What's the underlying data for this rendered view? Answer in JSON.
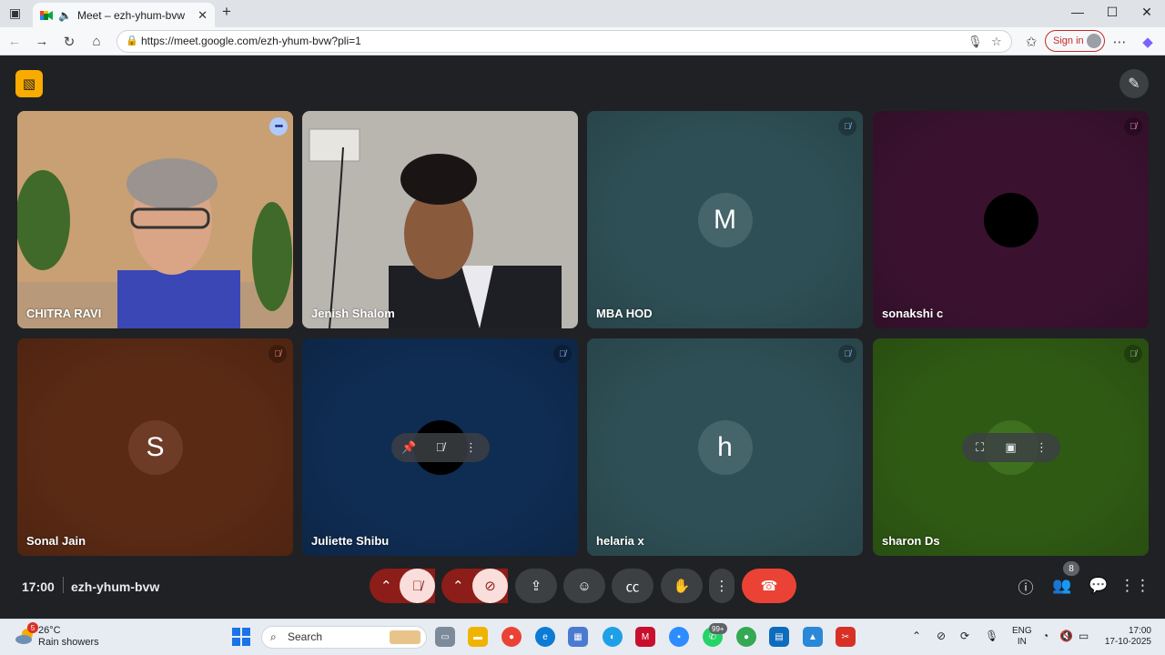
{
  "browser": {
    "tab_title": "Meet – ezh-yhum-bvw",
    "url": "https://meet.google.com/ezh-yhum-bvw?pli=1",
    "signin_label": "Sign in"
  },
  "tiles": [
    {
      "name": "CHITRA RAVI",
      "bg": "#c49a6c",
      "type": "video"
    },
    {
      "name": "Jenish Shalom",
      "bg": "#b9b6b0",
      "type": "video"
    },
    {
      "name": "MBA HOD",
      "bg": "#2e4f55",
      "type": "avatar",
      "initial": "M",
      "avatar_bg": "#45656b"
    },
    {
      "name": "sonakshi c",
      "bg": "#3a1230",
      "type": "avatar",
      "initial": "",
      "avatar_bg": "#000000"
    },
    {
      "name": "Sonal Jain",
      "bg": "#5a2a14",
      "type": "avatar",
      "initial": "S",
      "avatar_bg": "#6e3b27"
    },
    {
      "name": "Juliette Shibu",
      "bg": "#0f2c52",
      "type": "avatar",
      "initial": "",
      "avatar_bg": "#000000"
    },
    {
      "name": "helaria x",
      "bg": "#2e4f55",
      "type": "avatar",
      "initial": "h",
      "avatar_bg": "#45656b"
    },
    {
      "name": "sharon Ds",
      "bg": "#2f5a14",
      "type": "avatar",
      "initial": "",
      "avatar_bg": "#3e7020"
    }
  ],
  "meeting": {
    "time": "17:00",
    "code": "ezh-yhum-bvw",
    "participant_count": "8"
  },
  "taskbar": {
    "temp": "26°C",
    "weather": "Rain showers",
    "weather_badge": "5",
    "search_placeholder": "Search",
    "whatsapp_badge": "99+",
    "lang_line1": "ENG",
    "lang_line2": "IN",
    "time": "17:00",
    "date": "17-10-2025"
  },
  "colors": {
    "meet_bg": "#202124",
    "end_call": "#ea4335",
    "muted_dark": "#8c1d18",
    "muted_light": "#f9dedc",
    "accent_blue": "#8ab4f8"
  }
}
